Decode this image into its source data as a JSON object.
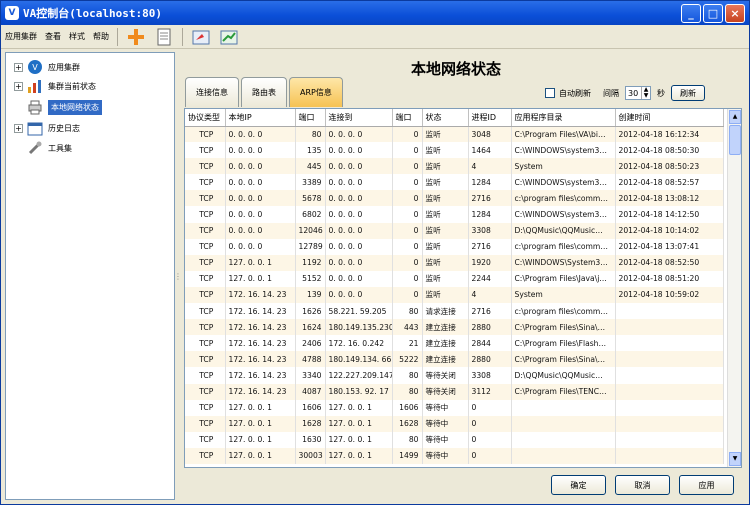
{
  "window": {
    "title": "VA控制台(localhost:80)",
    "min": "_",
    "max": "□",
    "close": "×"
  },
  "menu": [
    "应用集群",
    "查看",
    "样式",
    "帮助"
  ],
  "tree": [
    {
      "label": "应用集群",
      "expander": "+"
    },
    {
      "label": "集群当前状态",
      "expander": "+"
    },
    {
      "label": "本地网络状态",
      "expander": ""
    },
    {
      "label": "历史日志",
      "expander": "+"
    },
    {
      "label": "工具集",
      "expander": ""
    }
  ],
  "page_title": "本地网络状态",
  "tabs": [
    "连接信息",
    "路由表",
    "ARP信息"
  ],
  "refresh": {
    "auto_label": "自动刷新",
    "interval_label": "间隔",
    "interval_value": "30",
    "unit": "秒",
    "button": "刷新"
  },
  "table": {
    "columns": [
      "协议类型",
      "本地IP",
      "端口",
      "连接到",
      "端口",
      "状态",
      "进程ID",
      "应用程序目录",
      "创建时间"
    ],
    "rows": [
      [
        "TCP",
        "0. 0. 0. 0",
        "80",
        "0. 0. 0. 0",
        "0",
        "监听",
        "3048",
        "C:\\Program Files\\VA\\bi…",
        "2012-04-18 16:12:34"
      ],
      [
        "TCP",
        "0. 0. 0. 0",
        "135",
        "0. 0. 0. 0",
        "0",
        "监听",
        "1464",
        "C:\\WINDOWS\\system3…",
        "2012-04-18 08:50:30"
      ],
      [
        "TCP",
        "0. 0. 0. 0",
        "445",
        "0. 0. 0. 0",
        "0",
        "监听",
        "4",
        "System",
        "2012-04-18 08:50:23"
      ],
      [
        "TCP",
        "0. 0. 0. 0",
        "3389",
        "0. 0. 0. 0",
        "0",
        "监听",
        "1284",
        "C:\\WINDOWS\\system3…",
        "2012-04-18 08:52:57"
      ],
      [
        "TCP",
        "0. 0. 0. 0",
        "5678",
        "0. 0. 0. 0",
        "0",
        "监听",
        "2716",
        "c:\\program files\\comm…",
        "2012-04-18 13:08:12"
      ],
      [
        "TCP",
        "0. 0. 0. 0",
        "6802",
        "0. 0. 0. 0",
        "0",
        "监听",
        "1284",
        "C:\\WINDOWS\\system3…",
        "2012-04-18 14:12:50"
      ],
      [
        "TCP",
        "0. 0. 0. 0",
        "12046",
        "0. 0. 0. 0",
        "0",
        "监听",
        "3308",
        "D:\\QQMusic\\QQMusic…",
        "2012-04-18 10:14:02"
      ],
      [
        "TCP",
        "0. 0. 0. 0",
        "12789",
        "0. 0. 0. 0",
        "0",
        "监听",
        "2716",
        "c:\\program files\\comm…",
        "2012-04-18 13:07:41"
      ],
      [
        "TCP",
        "127. 0. 0. 1",
        "1192",
        "0. 0. 0. 0",
        "0",
        "监听",
        "1920",
        "C:\\WINDOWS\\System3…",
        "2012-04-18 08:52:50"
      ],
      [
        "TCP",
        "127. 0. 0. 1",
        "5152",
        "0. 0. 0. 0",
        "0",
        "监听",
        "2244",
        "C:\\Program Files\\Java\\j…",
        "2012-04-18 08:51:20"
      ],
      [
        "TCP",
        "172. 16. 14. 23",
        "139",
        "0. 0. 0. 0",
        "0",
        "监听",
        "4",
        "System",
        "2012-04-18 10:59:02"
      ],
      [
        "TCP",
        "172. 16. 14. 23",
        "1626",
        "58.221. 59.205",
        "80",
        "请求连接",
        "2716",
        "c:\\program files\\comm…",
        ""
      ],
      [
        "TCP",
        "172. 16. 14. 23",
        "1624",
        "180.149.135.230",
        "443",
        "建立连接",
        "2880",
        "C:\\Program Files\\Sina\\…",
        ""
      ],
      [
        "TCP",
        "172. 16. 14. 23",
        "2406",
        "172. 16. 0.242",
        "21",
        "建立连接",
        "2844",
        "C:\\Program Files\\Flash…",
        ""
      ],
      [
        "TCP",
        "172. 16. 14. 23",
        "4788",
        "180.149.134. 66",
        "5222",
        "建立连接",
        "2880",
        "C:\\Program Files\\Sina\\…",
        ""
      ],
      [
        "TCP",
        "172. 16. 14. 23",
        "3340",
        "122.227.209.147",
        "80",
        "等待关闭",
        "3308",
        "D:\\QQMusic\\QQMusic…",
        ""
      ],
      [
        "TCP",
        "172. 16. 14. 23",
        "4087",
        "180.153. 92. 17",
        "80",
        "等待关闭",
        "3112",
        "C:\\Program Files\\TENC…",
        ""
      ],
      [
        "TCP",
        "127. 0. 0. 1",
        "1606",
        "127. 0. 0. 1",
        "1606",
        "等待中",
        "0",
        "",
        ""
      ],
      [
        "TCP",
        "127. 0. 0. 1",
        "1628",
        "127. 0. 0. 1",
        "1628",
        "等待中",
        "0",
        "",
        ""
      ],
      [
        "TCP",
        "127. 0. 0. 1",
        "1630",
        "127. 0. 0. 1",
        "80",
        "等待中",
        "0",
        "",
        ""
      ],
      [
        "TCP",
        "127. 0. 0. 1",
        "30003",
        "127. 0. 0. 1",
        "1499",
        "等待中",
        "0",
        "",
        ""
      ]
    ]
  },
  "buttons": {
    "ok": "确定",
    "cancel": "取消",
    "apply": "应用"
  }
}
